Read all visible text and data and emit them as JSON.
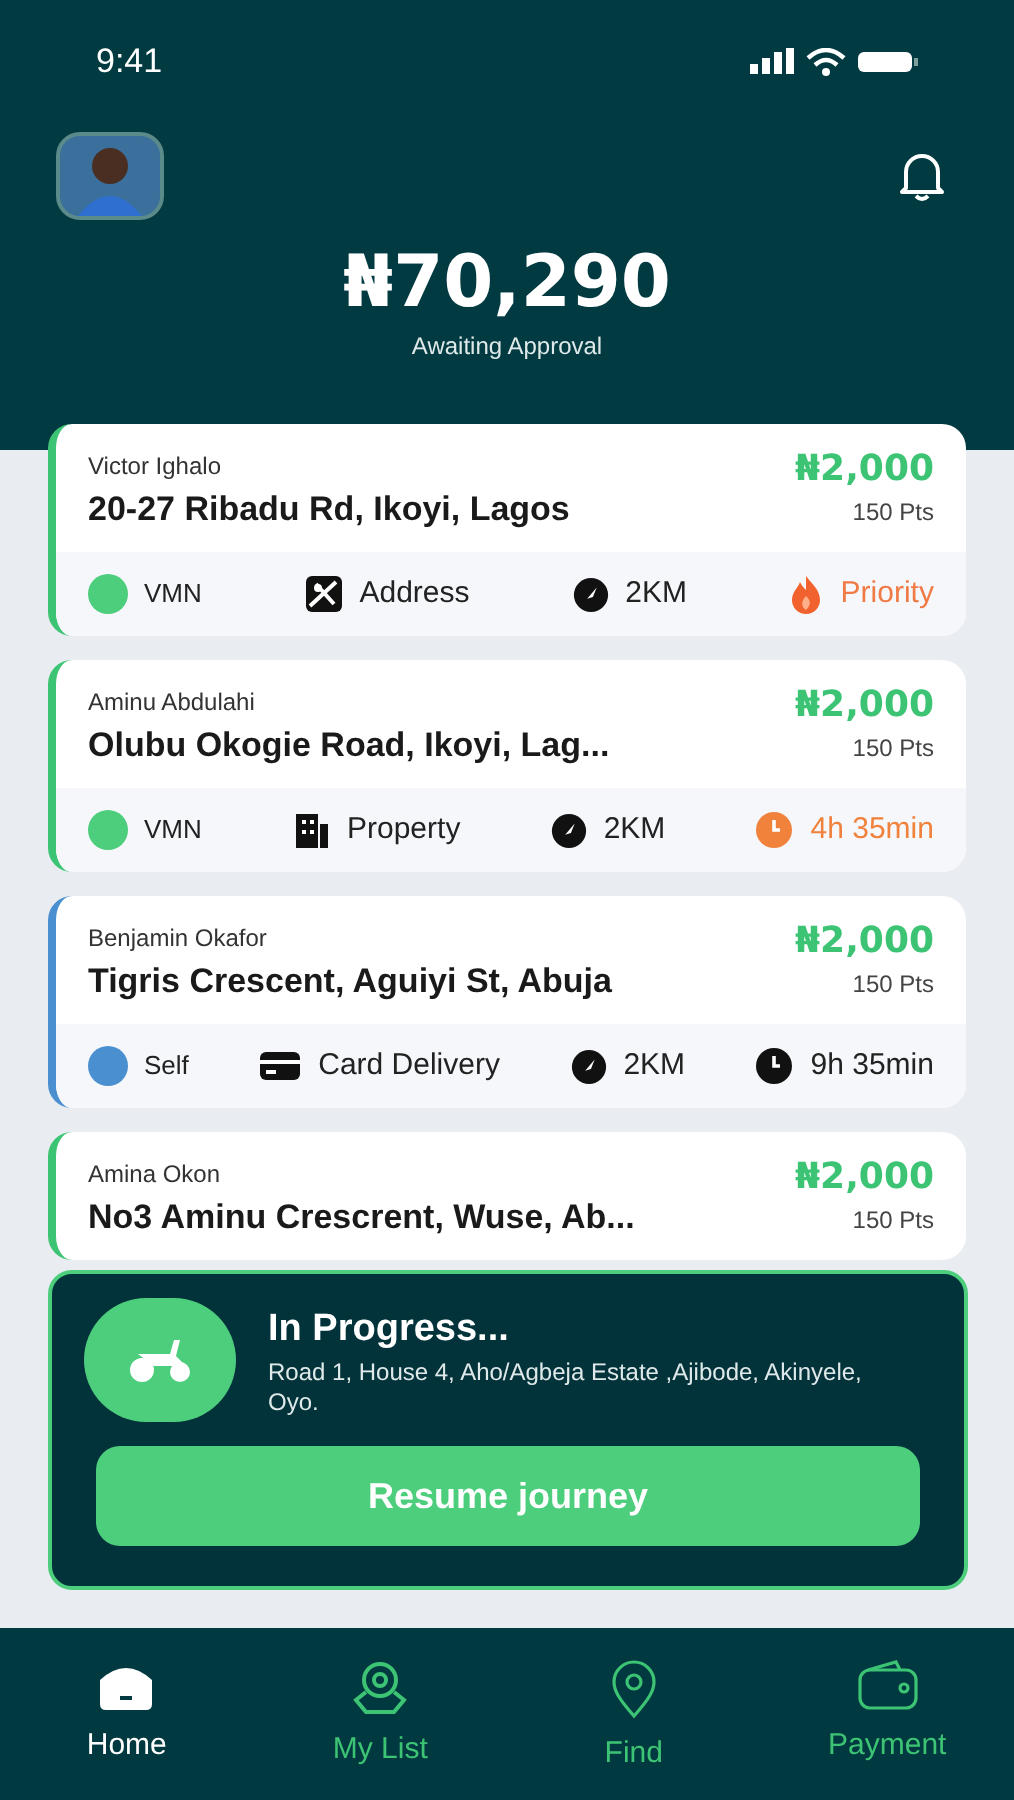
{
  "status_bar": {
    "time": "9:41"
  },
  "header": {
    "balance": "₦70,290",
    "balance_label": "Awaiting Approval"
  },
  "jobs": [
    {
      "name": "Victor Ighalo",
      "address": "20-27 Ribadu Rd, Ikoyi, Lagos",
      "price": "₦2,000",
      "points": "150 Pts",
      "color": "#3cc474",
      "tags": [
        {
          "kind": "dot",
          "color": "#4cce7c",
          "label": "VMN"
        },
        {
          "kind": "address",
          "label": "Address"
        },
        {
          "kind": "distance",
          "label": "2KM"
        },
        {
          "kind": "priority",
          "label": "Priority"
        }
      ]
    },
    {
      "name": "Aminu Abdulahi",
      "address": "Olubu Okogie Road, Ikoyi, Lag...",
      "price": "₦2,000",
      "points": "150 Pts",
      "color": "#3cc474",
      "tags": [
        {
          "kind": "dot",
          "color": "#4cce7c",
          "label": "VMN"
        },
        {
          "kind": "property",
          "label": "Property"
        },
        {
          "kind": "distance",
          "label": "2KM"
        },
        {
          "kind": "time",
          "urgent": true,
          "label": "4h 35min"
        }
      ]
    },
    {
      "name": "Benjamin Okafor",
      "address": "Tigris Crescent, Aguiyi St, Abuja",
      "price": "₦2,000",
      "points": "150 Pts",
      "color": "#4a90d0",
      "tags": [
        {
          "kind": "dot",
          "color": "#4a90d0",
          "label": "Self"
        },
        {
          "kind": "card",
          "label": "Card Delivery"
        },
        {
          "kind": "distance",
          "label": "2KM"
        },
        {
          "kind": "time",
          "urgent": false,
          "label": "9h 35min"
        }
      ]
    },
    {
      "name": "Amina Okon",
      "address": "No3 Aminu Crescrent, Wuse, Ab...",
      "price": "₦2,000",
      "points": "150 Pts",
      "color": "#3cc474"
    }
  ],
  "in_progress": {
    "title": "In Progress...",
    "address": "Road 1, House 4, Aho/Agbeja Estate ,Ajibode, Akinyele, Oyo.",
    "button": "Resume journey"
  },
  "nav": [
    {
      "label": "Home",
      "kind": "home",
      "selected": true
    },
    {
      "label": "My List",
      "kind": "list",
      "selected": false
    },
    {
      "label": "Find",
      "kind": "find",
      "selected": false
    },
    {
      "label": "Payment",
      "kind": "payment",
      "selected": false
    }
  ]
}
